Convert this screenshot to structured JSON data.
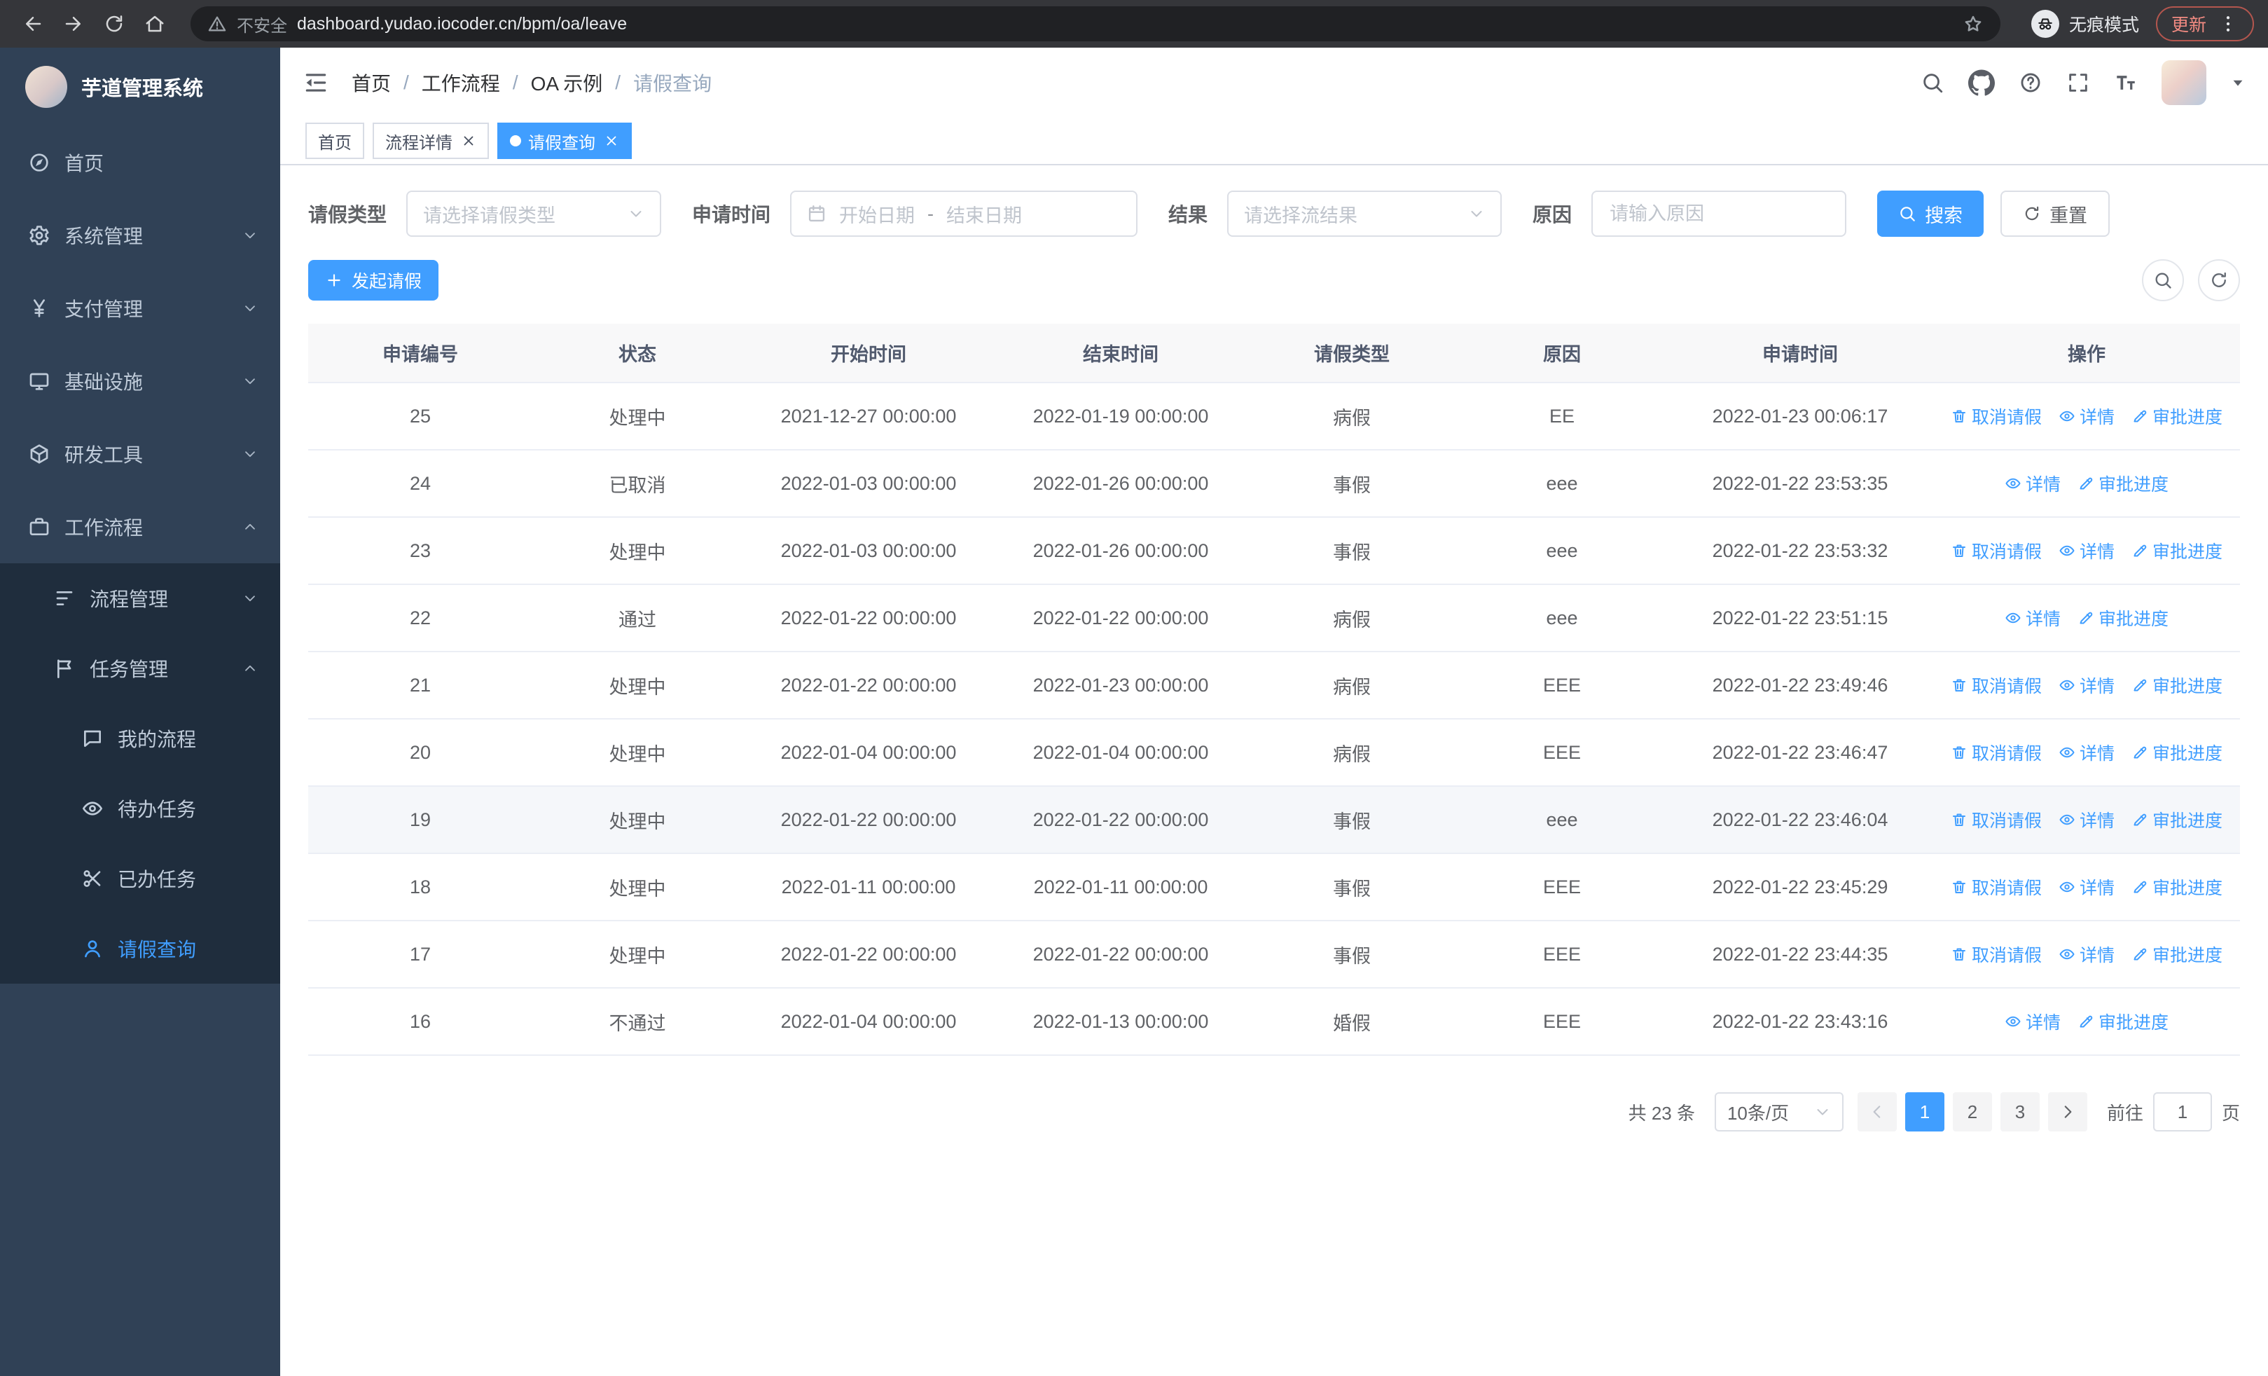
{
  "theme": {
    "primary": "#409eff",
    "sidebar_bg": "#304156",
    "sidebar_submenu_bg": "#1f2d3d"
  },
  "browser": {
    "security_warning": "不安全",
    "url": "dashboard.yudao.iocoder.cn/bpm/oa/leave",
    "incognito_label": "无痕模式",
    "update_label": "更新"
  },
  "sidebar": {
    "logo_title": "芋道管理系统",
    "items": [
      {
        "name": "sidebar-item-home",
        "label": "首页",
        "icon": "dashboard-icon",
        "chevron": ""
      },
      {
        "name": "sidebar-item-system-mgmt",
        "label": "系统管理",
        "icon": "gear-icon",
        "chevron": "down"
      },
      {
        "name": "sidebar-item-payment-mgmt",
        "label": "支付管理",
        "icon": "yen-icon",
        "chevron": "down"
      },
      {
        "name": "sidebar-item-infrastructure",
        "label": "基础设施",
        "icon": "monitor-icon",
        "chevron": "down"
      },
      {
        "name": "sidebar-item-dev-tools",
        "label": "研发工具",
        "icon": "toolbox-icon",
        "chevron": "down"
      },
      {
        "name": "sidebar-item-workflow",
        "label": "工作流程",
        "icon": "briefcase-icon",
        "chevron": "up"
      }
    ],
    "workflow_children": [
      {
        "name": "sidebar-item-process-mgmt",
        "label": "流程管理",
        "icon": "tree-icon",
        "chevron": "down"
      },
      {
        "name": "sidebar-item-task-mgmt",
        "label": "任务管理",
        "icon": "flag-icon",
        "chevron": "up",
        "expanded": true
      }
    ],
    "task_children": [
      {
        "name": "sidebar-item-my-process",
        "label": "我的流程",
        "icon": "chat-icon"
      },
      {
        "name": "sidebar-item-todo-tasks",
        "label": "待办任务",
        "icon": "eye-icon"
      },
      {
        "name": "sidebar-item-done-tasks",
        "label": "已办任务",
        "icon": "scissors-icon"
      },
      {
        "name": "sidebar-item-leave-query",
        "label": "请假查询",
        "icon": "user-icon",
        "active": true
      }
    ]
  },
  "header": {
    "breadcrumb": [
      "首页",
      "工作流程",
      "OA 示例",
      "请假查询"
    ],
    "separator": "/"
  },
  "tabs": [
    {
      "name": "tab-home",
      "label": "首页",
      "closable": false,
      "active": false
    },
    {
      "name": "tab-process-detail",
      "label": "流程详情",
      "closable": true,
      "active": false
    },
    {
      "name": "tab-leave-query",
      "label": "请假查询",
      "closable": true,
      "active": true
    }
  ],
  "filters": {
    "leave_type_label": "请假类型",
    "leave_type_placeholder": "请选择请假类型",
    "apply_time_label": "申请时间",
    "start_date_placeholder": "开始日期",
    "range_separator": "-",
    "end_date_placeholder": "结束日期",
    "result_label": "结果",
    "result_placeholder": "请选择流结果",
    "reason_label": "原因",
    "reason_placeholder": "请输入原因",
    "search_button": "搜索",
    "reset_button": "重置"
  },
  "toolbar": {
    "create_button": "发起请假"
  },
  "table": {
    "headers": [
      "申请编号",
      "状态",
      "开始时间",
      "结束时间",
      "请假类型",
      "原因",
      "申请时间",
      "操作"
    ],
    "action_defs": {
      "cancel": {
        "label": "取消请假",
        "icon": "trash-icon"
      },
      "detail": {
        "label": "详情",
        "icon": "eye-icon"
      },
      "progress": {
        "label": "审批进度",
        "icon": "edit-icon"
      }
    },
    "rows": [
      {
        "id": "25",
        "status": "处理中",
        "start": "2021-12-27 00:00:00",
        "end": "2022-01-19 00:00:00",
        "type": "病假",
        "reason": "EE",
        "applied": "2022-01-23 00:06:17",
        "actions": [
          "cancel",
          "detail",
          "progress"
        ]
      },
      {
        "id": "24",
        "status": "已取消",
        "start": "2022-01-03 00:00:00",
        "end": "2022-01-26 00:00:00",
        "type": "事假",
        "reason": "eee",
        "applied": "2022-01-22 23:53:35",
        "actions": [
          "detail",
          "progress"
        ]
      },
      {
        "id": "23",
        "status": "处理中",
        "start": "2022-01-03 00:00:00",
        "end": "2022-01-26 00:00:00",
        "type": "事假",
        "reason": "eee",
        "applied": "2022-01-22 23:53:32",
        "actions": [
          "cancel",
          "detail",
          "progress"
        ]
      },
      {
        "id": "22",
        "status": "通过",
        "start": "2022-01-22 00:00:00",
        "end": "2022-01-22 00:00:00",
        "type": "病假",
        "reason": "eee",
        "applied": "2022-01-22 23:51:15",
        "actions": [
          "detail",
          "progress"
        ]
      },
      {
        "id": "21",
        "status": "处理中",
        "start": "2022-01-22 00:00:00",
        "end": "2022-01-23 00:00:00",
        "type": "病假",
        "reason": "EEE",
        "applied": "2022-01-22 23:49:46",
        "actions": [
          "cancel",
          "detail",
          "progress"
        ]
      },
      {
        "id": "20",
        "status": "处理中",
        "start": "2022-01-04 00:00:00",
        "end": "2022-01-04 00:00:00",
        "type": "病假",
        "reason": "EEE",
        "applied": "2022-01-22 23:46:47",
        "actions": [
          "cancel",
          "detail",
          "progress"
        ]
      },
      {
        "id": "19",
        "status": "处理中",
        "start": "2022-01-22 00:00:00",
        "end": "2022-01-22 00:00:00",
        "type": "事假",
        "reason": "eee",
        "applied": "2022-01-22 23:46:04",
        "actions": [
          "cancel",
          "detail",
          "progress"
        ],
        "highlight": true
      },
      {
        "id": "18",
        "status": "处理中",
        "start": "2022-01-11 00:00:00",
        "end": "2022-01-11 00:00:00",
        "type": "事假",
        "reason": "EEE",
        "applied": "2022-01-22 23:45:29",
        "actions": [
          "cancel",
          "detail",
          "progress"
        ]
      },
      {
        "id": "17",
        "status": "处理中",
        "start": "2022-01-22 00:00:00",
        "end": "2022-01-22 00:00:00",
        "type": "事假",
        "reason": "EEE",
        "applied": "2022-01-22 23:44:35",
        "actions": [
          "cancel",
          "detail",
          "progress"
        ]
      },
      {
        "id": "16",
        "status": "不通过",
        "start": "2022-01-04 00:00:00",
        "end": "2022-01-13 00:00:00",
        "type": "婚假",
        "reason": "EEE",
        "applied": "2022-01-22 23:43:16",
        "actions": [
          "detail",
          "progress"
        ]
      }
    ]
  },
  "pagination": {
    "total_text": "共 23 条",
    "page_size": "10条/页",
    "pages": [
      "1",
      "2",
      "3"
    ],
    "current_page": "1",
    "goto_label": "前往",
    "goto_value": "1",
    "goto_suffix": "页"
  }
}
